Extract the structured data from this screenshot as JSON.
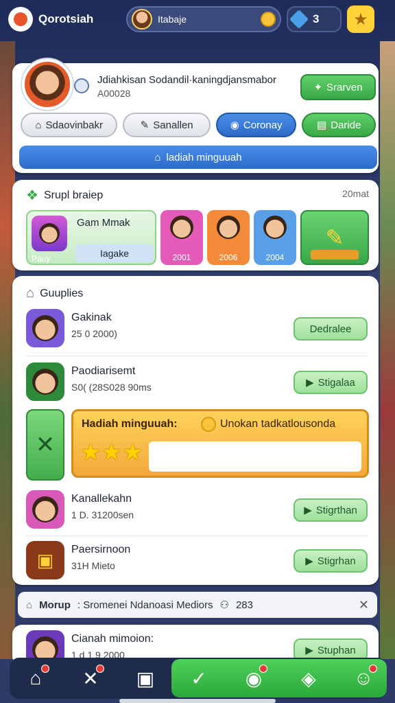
{
  "topbar": {
    "app_title": "Qorotsiah",
    "username": "Itabaje",
    "gem_count": "3"
  },
  "profile": {
    "name": "Jdiahkisan Sodandil·kaningdjansmabor",
    "id": "A00028",
    "save_label": "Srarven",
    "tabs": [
      {
        "label": "Sdaovinbakr"
      },
      {
        "label": "Sanallen"
      },
      {
        "label": "Coronay"
      },
      {
        "label": "Daride"
      }
    ],
    "wide_button": "ladiah minguuah"
  },
  "group": {
    "title": "Srupl braiep",
    "right_text": "20mat",
    "featured": {
      "title": "Gam Mmak",
      "label": "Pauy",
      "sub": "Iagake"
    },
    "tiles": [
      {
        "year": "2001",
        "color": "#e45ab8"
      },
      {
        "year": "2006",
        "color": "#f28a3a"
      },
      {
        "year": "2004",
        "color": "#5aa0e8"
      }
    ]
  },
  "supplies": {
    "title": "Guuplies",
    "rows": [
      {
        "name": "Gakinak",
        "sub": "25 0 2000)",
        "button": "Dedralee",
        "color": "#7a5ad8"
      },
      {
        "name": "Paodiarisemt",
        "sub": "S0( (28S028 90ms",
        "button": "Stigalaa",
        "color": "#2e8a3a"
      },
      {
        "name": "Kanallekahn",
        "sub": "1 D. 31200sen",
        "button": "Stigrthan",
        "color": "#d85ab8"
      },
      {
        "name": "Paersirnoon",
        "sub": "31H Mieto",
        "button": "Stigrhan",
        "color": "#8a3a1a"
      }
    ],
    "banner": {
      "title": "Hadiah minguuah:",
      "text": "Unokan tadkatlousonda"
    }
  },
  "morup": {
    "label": "Morup",
    "text": ": Sromenei Ndanoasi Mediors",
    "count": "283"
  },
  "last_row": {
    "name": "Cianah mimoion:",
    "sub": "1 d 1 9 2000",
    "button": "Stuphan"
  }
}
